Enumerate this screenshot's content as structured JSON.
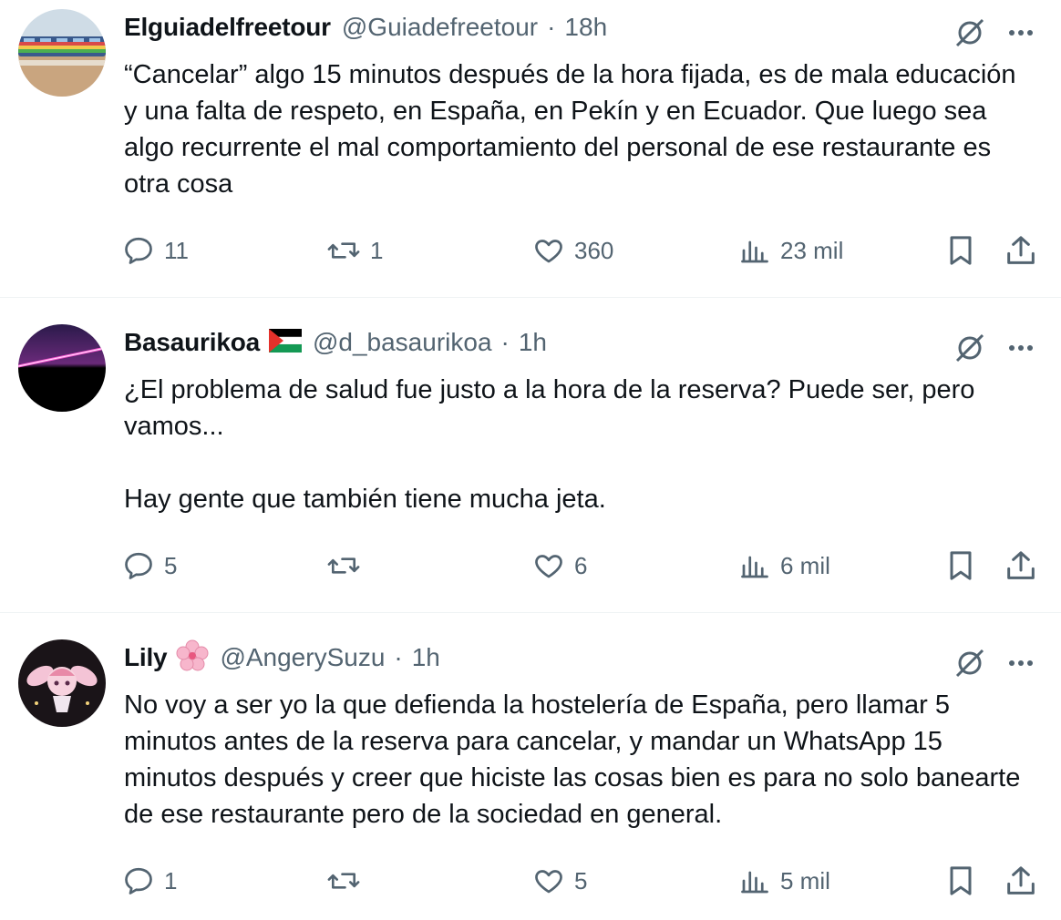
{
  "tweets": [
    {
      "name": "Elguiadelfreetour",
      "handle": "@Guiadefreetour",
      "separator": "·",
      "time": "18h",
      "text": "“Cancelar” algo 15 minutos después de la hora fijada, es de mala educación y una falta de respeto, en España, en Pekín y en Ecuador. Que luego sea algo recurrente el mal comportamiento del personal de ese restaurante es otra cosa",
      "replies": "11",
      "retweets": "1",
      "likes": "360",
      "views": "23 mil",
      "avatar": "tram-photo"
    },
    {
      "name": "Basaurikoa",
      "name_emoji": "palestine-flag",
      "handle": "@d_basaurikoa",
      "separator": "·",
      "time": "1h",
      "text": "¿El problema de salud fue justo a la hora de la reserva? Puede ser, pero vamos...\n\nHay gente que también tiene mucha jeta.",
      "replies": "5",
      "retweets": "",
      "likes": "6",
      "views": "6 mil",
      "avatar": "neon-horizon"
    },
    {
      "name": "Lily",
      "name_emoji": "cherry-blossom",
      "handle": "@AngerySuzu",
      "separator": "·",
      "time": "1h",
      "text": "No voy a ser yo la que defienda la hostelería de España, pero llamar 5 minutos antes de la reserva para cancelar, y mandar un WhatsApp 15 minutos después y creer que hiciste las cosas bien es para no solo banearte de ese restaurante pero de la sociedad en general.",
      "replies": "1",
      "retweets": "",
      "likes": "5",
      "views": "5 mil",
      "avatar": "anime-character"
    }
  ],
  "colors": {
    "secondary": "#536471",
    "divider": "#eff3f4",
    "text": "#0f1419"
  }
}
